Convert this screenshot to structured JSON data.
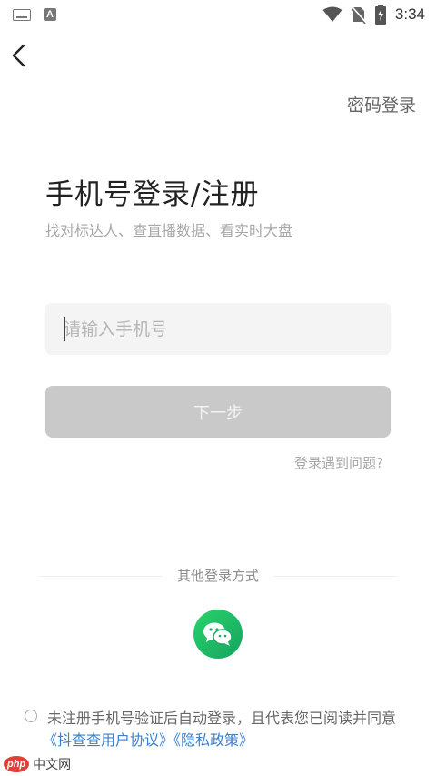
{
  "status_bar": {
    "time": "3:34"
  },
  "header": {
    "password_login": "密码登录"
  },
  "main": {
    "title": "手机号登录/注册",
    "subtitle": "找对标达人、查直播数据、看实时大盘",
    "phone_input": {
      "placeholder": "请输入手机号",
      "value": ""
    },
    "next_button": "下一步",
    "login_problem": "登录遇到问题?"
  },
  "other_login": {
    "label": "其他登录方式"
  },
  "agreement": {
    "text": "未注册手机号验证后自动登录，且代表您已阅读并同意",
    "user_agreement": "《抖查查用户协议》",
    "privacy_policy": "《隐私政策》"
  },
  "watermark": {
    "logo": "php",
    "text": "中文网"
  },
  "colors": {
    "accent": "#3b7fd2",
    "wechat": "#1aae64",
    "disabled_button": "#c9c9c9"
  }
}
